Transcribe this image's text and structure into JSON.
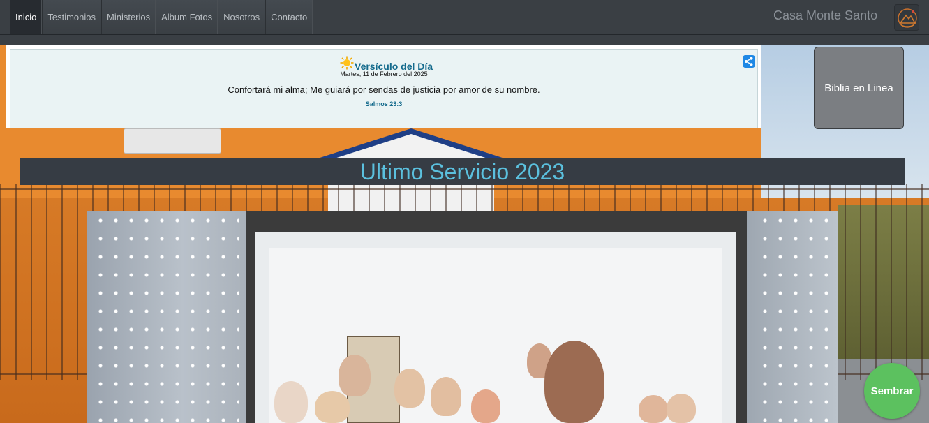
{
  "nav": {
    "items": [
      {
        "label": "Inicio",
        "active": true
      },
      {
        "label": "Testimonios",
        "active": false
      },
      {
        "label": "Ministerios",
        "active": false
      },
      {
        "label": "Album Fotos",
        "active": false
      },
      {
        "label": "Nosotros",
        "active": false
      },
      {
        "label": "Contacto",
        "active": false
      }
    ],
    "brand": "Casa Monte Santo",
    "logo_icon": "mountain-logo-icon"
  },
  "verse": {
    "title": "Versículo del Día",
    "date": "Martes, 11 de Febrero del 2025",
    "text": "Confortará mi alma; Me guiará por sendas de justicia por amor de su nombre.",
    "reference": "Salmos 23:3",
    "icons": [
      "sun-icon",
      "share-icon"
    ]
  },
  "biblia_button": {
    "label": "Biblia en Linea"
  },
  "service": {
    "title": "Ultimo Servicio 2023"
  },
  "sembrar_button": {
    "label": "Sembrar"
  },
  "colors": {
    "navbar": "#3a3f44",
    "accent_title": "#5bc0de",
    "verse_title": "#146a8c",
    "sembrar": "#5cc15f",
    "wall": "#e88a2f"
  }
}
